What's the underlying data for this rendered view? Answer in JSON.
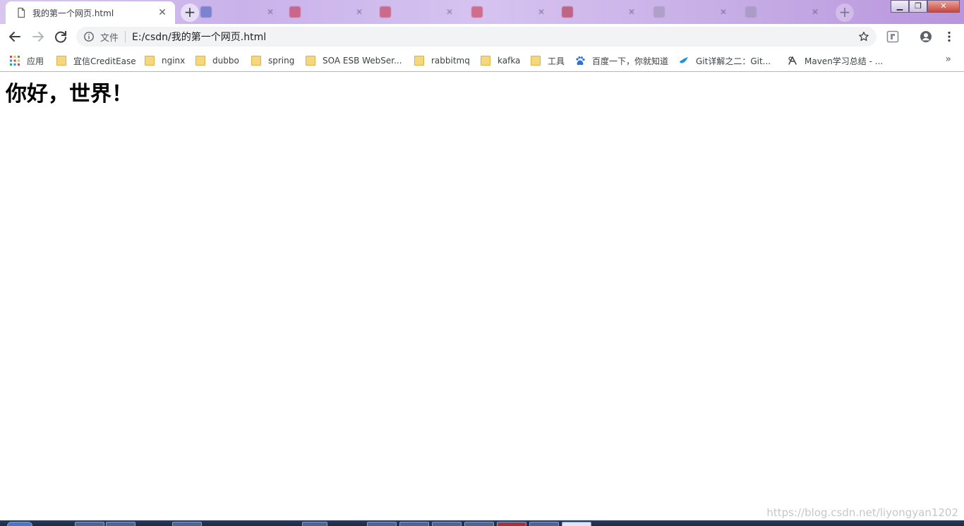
{
  "tabs": {
    "active": {
      "title": "我的第一个网页.html"
    },
    "background": [
      {
        "color": "#3b5bb8"
      },
      {
        "color": "#c8283c"
      },
      {
        "color": "#c8283c"
      },
      {
        "color": "#c8283c"
      },
      {
        "color": "#b01e30"
      },
      {
        "color": "#9a8fb0"
      },
      {
        "color": "#9a8fb0"
      }
    ]
  },
  "toolbar": {
    "scheme_label": "文件",
    "url": "E:/csdn/我的第一个网页.html"
  },
  "bookmarks": [
    {
      "label": "应用",
      "icon": "apps-grid-icon"
    },
    {
      "label": "宜信CreditEase",
      "icon": "folder-icon"
    },
    {
      "label": "nginx",
      "icon": "folder-icon"
    },
    {
      "label": "dubbo",
      "icon": "folder-icon"
    },
    {
      "label": "spring",
      "icon": "folder-icon"
    },
    {
      "label": "SOA ESB WebSer...",
      "icon": "folder-icon"
    },
    {
      "label": "rabbitmq",
      "icon": "folder-icon"
    },
    {
      "label": "kafka",
      "icon": "folder-icon"
    },
    {
      "label": "工具",
      "icon": "folder-icon"
    },
    {
      "label": "百度一下，你就知道",
      "icon": "baidu-paw-icon"
    },
    {
      "label": "Git详解之二：Git...",
      "icon": "bird-icon"
    },
    {
      "label": "Maven学习总结 - ...",
      "icon": "maven-icon"
    }
  ],
  "bookmarks_more": "»",
  "page": {
    "heading": "你好，世界！"
  },
  "watermark": "https://blog.csdn.net/liyongyan1202",
  "colors": {
    "tabstrip": "#c9b2ea",
    "omnibox": "#f1f3f4",
    "folder": "#f6d77a"
  }
}
